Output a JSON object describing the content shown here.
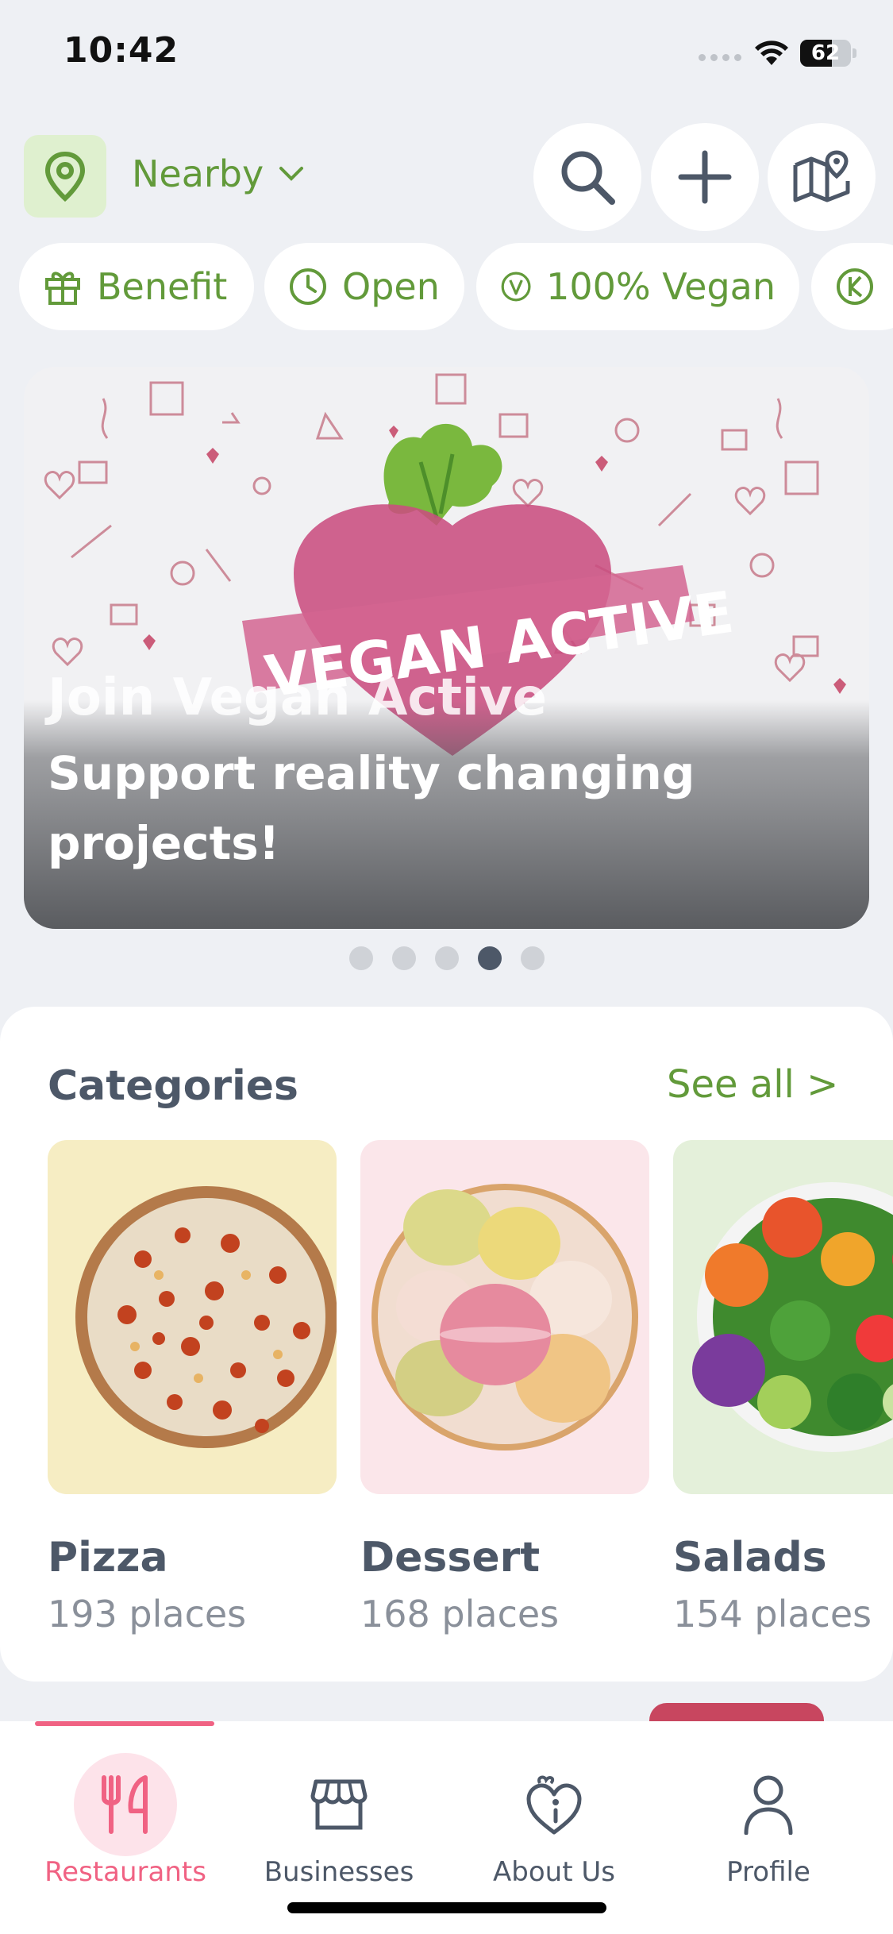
{
  "status_bar": {
    "time": "10:42",
    "battery": "62",
    "battery_level": 0.62
  },
  "header": {
    "location_label": "Nearby",
    "icons": [
      "location-pin-icon",
      "chevron-down-icon",
      "search-icon",
      "plus-icon",
      "map-pin-icon"
    ]
  },
  "filters": [
    {
      "label": "Benefit",
      "icon": "gift-icon"
    },
    {
      "label": "Open",
      "icon": "clock-icon"
    },
    {
      "label": "100% Vegan",
      "icon": "vegan-v-icon"
    },
    {
      "label": "",
      "icon": "kosher-k-icon"
    }
  ],
  "banner": {
    "logo_text": "VEGAN ACTIVE",
    "title": "Join Vegan Active",
    "subtitle": "Support reality changing projects!",
    "page_count": 5,
    "active_page": 4
  },
  "categories": {
    "title": "Categories",
    "see_all": "See all >",
    "items": [
      {
        "name": "Pizza",
        "count": "193 places"
      },
      {
        "name": "Dessert",
        "count": "168 places"
      },
      {
        "name": "Salads",
        "count": "154 places"
      }
    ]
  },
  "bottom_nav": {
    "items": [
      {
        "label": "Restaurants",
        "icon": "fork-knife-icon",
        "active": true
      },
      {
        "label": "Businesses",
        "icon": "storefront-icon",
        "active": false
      },
      {
        "label": "About Us",
        "icon": "heart-info-icon",
        "active": false
      },
      {
        "label": "Profile",
        "icon": "person-icon",
        "active": false
      }
    ]
  },
  "colors": {
    "accent_green": "#629a3a",
    "accent_pink": "#f06283",
    "text_dark": "#4d5868",
    "background": "#eef0f4"
  }
}
